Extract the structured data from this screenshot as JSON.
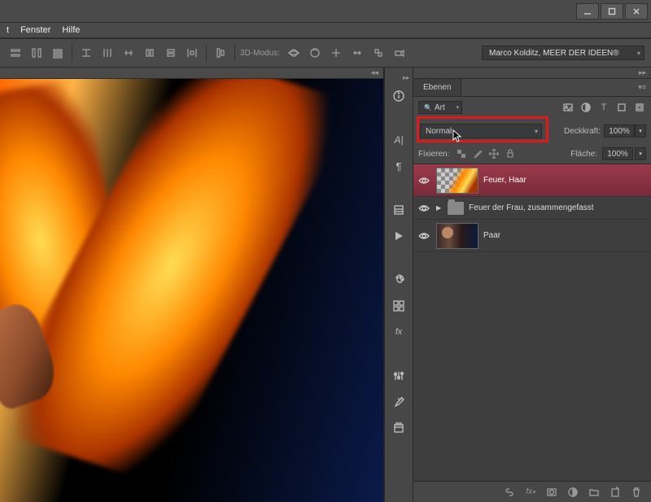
{
  "menu": {
    "item1": "Fenster",
    "item2": "Hilfe",
    "item0_partial": "t"
  },
  "options": {
    "mode3d_label": "3D-Modus:",
    "author": "Marco Kolditz, MEER DER IDEEN®"
  },
  "layers_panel": {
    "tab": "Ebenen",
    "search_kind": "Art",
    "blend_mode": "Normal",
    "opacity_label": "Deckkraft:",
    "opacity_value": "100%",
    "fill_label": "Fläche:",
    "fill_value": "100%",
    "lock_label": "Fixieren:",
    "layers": [
      {
        "name": "Feuer, Haar",
        "selected": true,
        "kind": "pixel"
      },
      {
        "name": "Feuer der Frau, zusammengefasst",
        "selected": false,
        "kind": "folder"
      },
      {
        "name": "Paar",
        "selected": false,
        "kind": "pixel"
      }
    ],
    "footer_fx": "fx"
  }
}
